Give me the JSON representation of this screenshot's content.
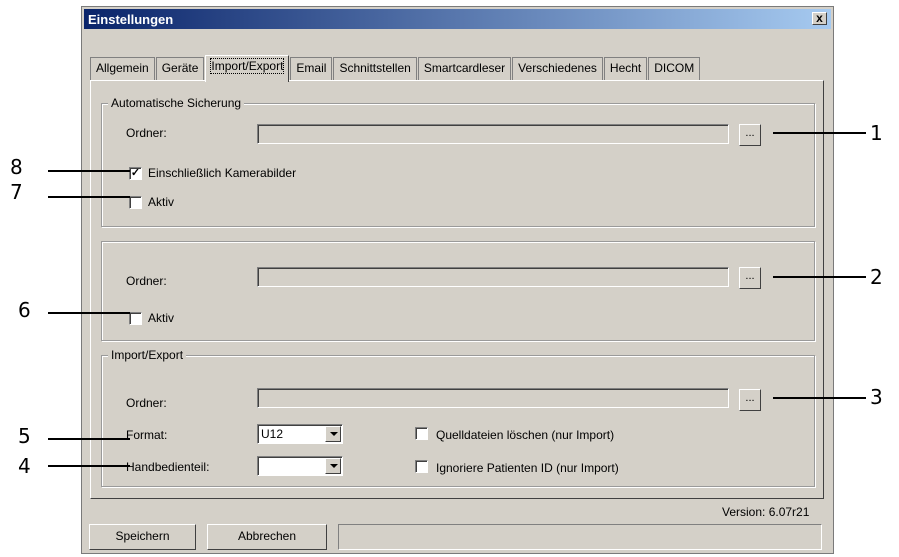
{
  "window": {
    "title": "Einstellungen",
    "close_glyph": "x"
  },
  "tabs": [
    "Allgemein",
    "Geräte",
    "Import/Export",
    "Email",
    "Schnittstellen",
    "Smartcardleser",
    "Verschiedenes",
    "Hecht",
    "DICOM"
  ],
  "active_tab": "Import/Export",
  "sections": {
    "auto_backup": {
      "legend": "Automatische Sicherung",
      "folder_label": "Ordner:",
      "folder_value": "",
      "browse_label": "...",
      "include_camera_label": "Einschließlich Kamerabilder",
      "include_camera_checked": true,
      "active_label": "Aktiv",
      "active_checked": false
    },
    "second": {
      "legend": "",
      "folder_label": "Ordner:",
      "folder_value": "",
      "browse_label": "...",
      "active_label": "Aktiv",
      "active_checked": false
    },
    "import_export": {
      "legend": "Import/Export",
      "folder_label": "Ordner:",
      "folder_value": "",
      "browse_label": "...",
      "format_label": "Format:",
      "format_value": "U12",
      "handset_label": "Handbedienteil:",
      "handset_value": "",
      "delete_source_label": "Quelldateien löschen (nur Import)",
      "delete_source_checked": false,
      "ignore_patient_label": "Ignoriere Patienten ID (nur Import)",
      "ignore_patient_checked": false
    }
  },
  "version_text": "Version: 6.07r21",
  "buttons": {
    "save": "Speichern",
    "cancel": "Abbrechen"
  },
  "callouts": {
    "c1": "1",
    "c2": "2",
    "c3": "3",
    "c4": "4",
    "c5": "5",
    "c6": "6",
    "c7": "7",
    "c8": "8"
  }
}
